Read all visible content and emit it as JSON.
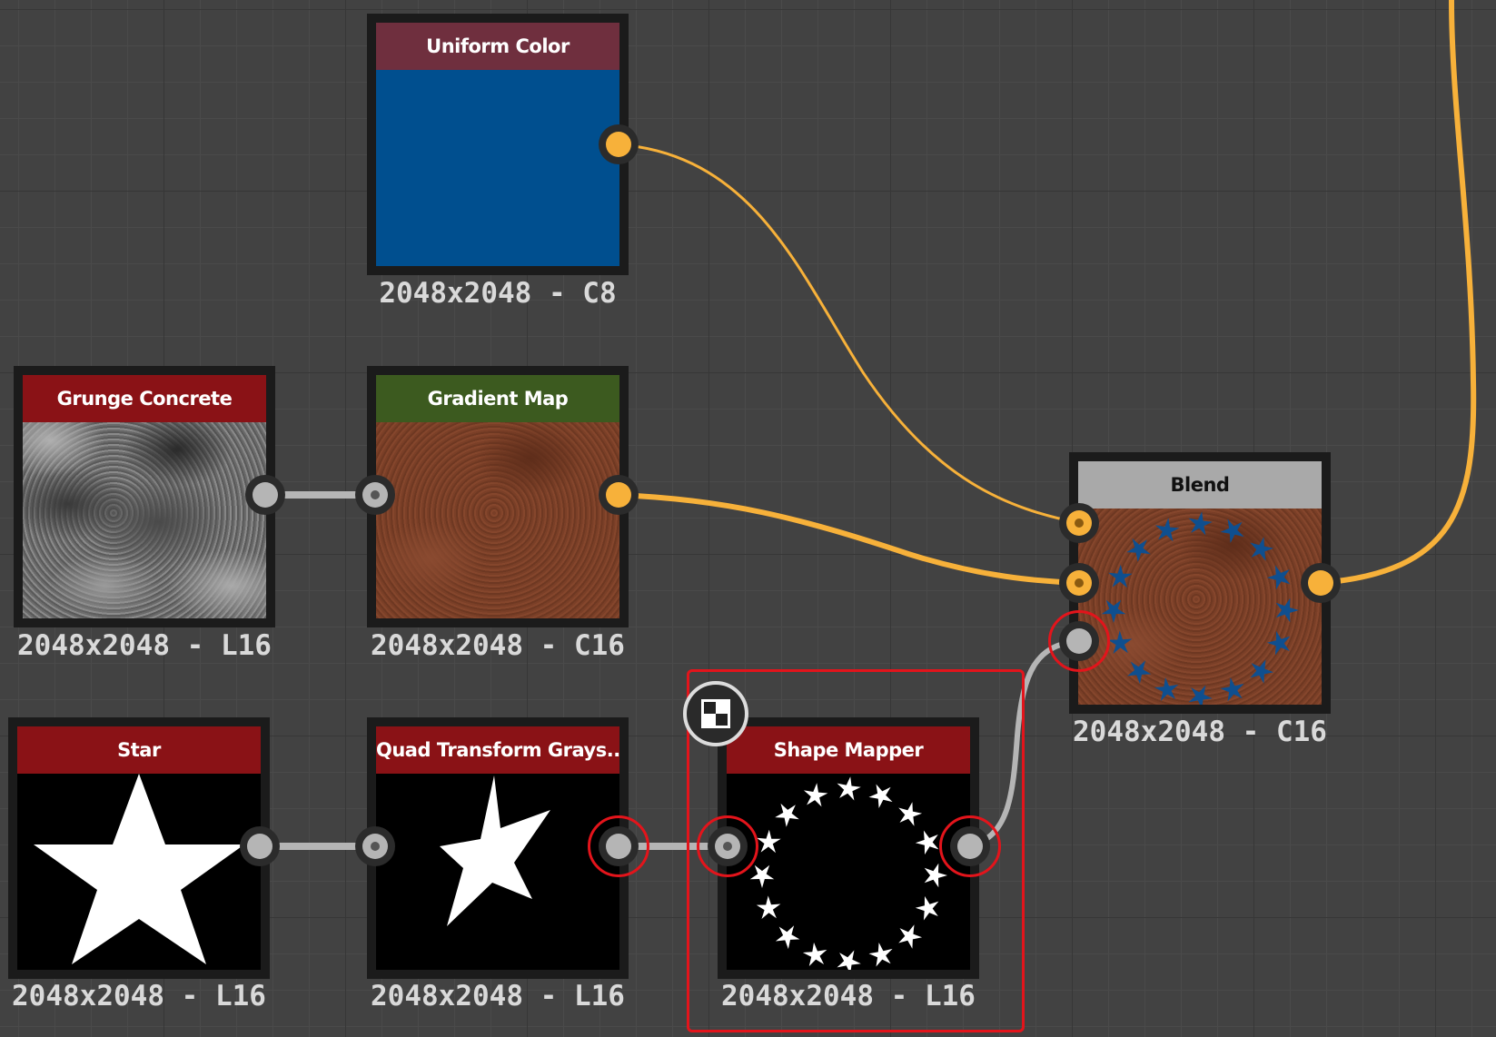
{
  "nodes": {
    "uniform_color": {
      "title": "Uniform Color",
      "size": "2048x2048 - C8",
      "fill": "#004f8f"
    },
    "grunge_concrete": {
      "title": "Grunge Concrete",
      "size": "2048x2048 - L16"
    },
    "gradient_map": {
      "title": "Gradient Map",
      "size": "2048x2048 - C16"
    },
    "star": {
      "title": "Star",
      "size": "2048x2048 - L16"
    },
    "quad_transform": {
      "title": "Quad Transform Grays...",
      "size": "2048x2048 - L16"
    },
    "shape_mapper": {
      "title": "Shape Mapper",
      "size": "2048x2048 - L16"
    },
    "blend": {
      "title": "Blend",
      "size": "2048x2048 - C16"
    }
  },
  "colors": {
    "canvas": "#424242",
    "connection_color": "#f7b13a",
    "connection_grayscale": "#b5b5b5",
    "selection": "#e3141b",
    "header_generator": "#8a1216",
    "header_uniform": "#6f2f3e",
    "header_filter": "#3c5a1f",
    "header_blend": "#a9a9a9"
  },
  "icons": {
    "compare_button": "checker-compare-icon"
  }
}
